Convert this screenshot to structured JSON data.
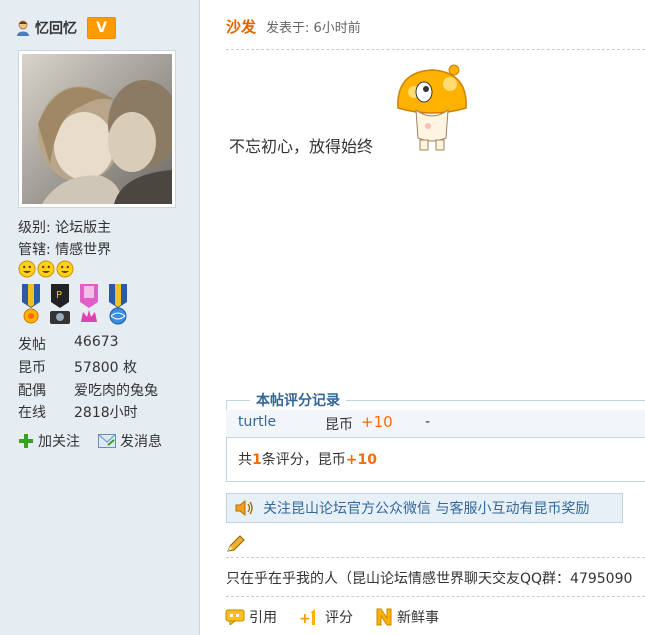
{
  "profile": {
    "username": "忆回忆",
    "vip_badge": "V",
    "level": "级别: 论坛版主",
    "manage": "管辖: 情感世界",
    "stats": [
      {
        "label": "发帖",
        "value": "46673"
      },
      {
        "label": "昆币",
        "value": "57800 枚"
      },
      {
        "label": "配偶",
        "value": "爱吃肉的兔兔"
      },
      {
        "label": "在线",
        "value": "2818小时"
      }
    ],
    "follow_label": "加关注",
    "message_label": "发消息"
  },
  "post": {
    "author": "沙发",
    "time": "发表于: 6小时前",
    "content": "不忘初心，放得始终"
  },
  "rating": {
    "title": "本帖评分记录",
    "rows": [
      {
        "user": "turtle",
        "currency": "昆币",
        "amount": "+10",
        "reason": "-"
      }
    ],
    "summary_prefix": "共",
    "summary_count": "1",
    "summary_mid": "条评分，昆币",
    "summary_total": "+10"
  },
  "notice": "关注昆山论坛官方公众微信 与客服小互动有昆币奖励",
  "signature": "只在乎在乎我的人（昆山论坛情感世界聊天交友QQ群：4795090",
  "actions": {
    "quote": "引用",
    "rate": "评分",
    "fresh": "新鲜事"
  },
  "colors": {
    "accent_orange": "#e06500",
    "link_blue": "#336699",
    "sidebar_bg": "#e5edf2"
  }
}
